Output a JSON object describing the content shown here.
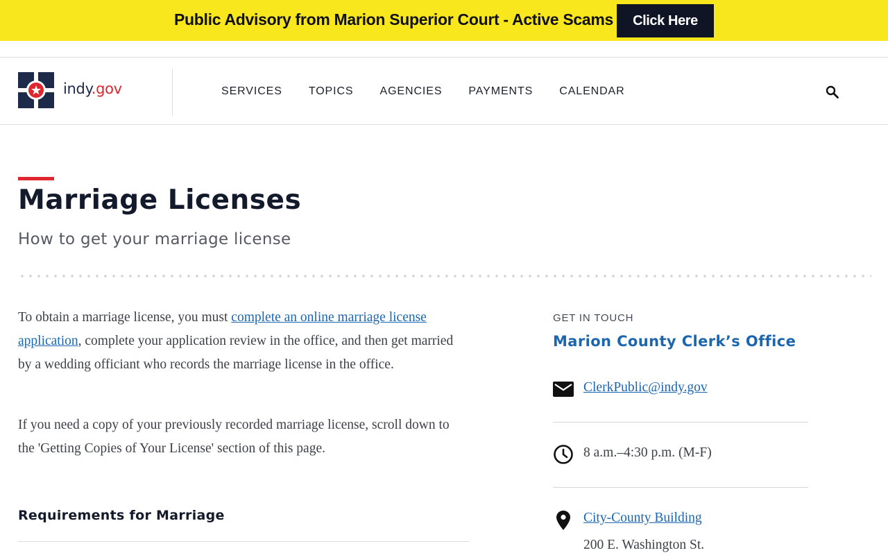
{
  "advisory": {
    "text": "Public Advisory from Marion Superior Court - Active Scams",
    "button_label": "Click Here",
    "background_color": "#f8e71c",
    "button_color": "#0f1524"
  },
  "header": {
    "logo": {
      "word_part1": "indy",
      "word_part2": ".gov",
      "icon": "indy-star-logo-icon"
    },
    "nav": [
      "SERVICES",
      "TOPICS",
      "AGENCIES",
      "PAYMENTS",
      "CALENDAR"
    ],
    "search_icon": "search-icon"
  },
  "page": {
    "title": "Marriage Licenses",
    "subtitle": "How to get your marriage license",
    "accent_color": "#e0262f"
  },
  "content": {
    "intro_before_link": "To obtain a marriage license, you must ",
    "intro_link": "complete an online marriage license application",
    "intro_after_link": ", complete your application review in the office, and then get married by a wedding officiant who records the marriage license in the office.",
    "copies_text": "If you need a copy of your previously recorded marriage license, scroll down to the 'Getting Copies of Your License' section of this page.",
    "requirements_heading": "Requirements for Marriage",
    "link_color": "#1c66b0"
  },
  "contact": {
    "eyebrow": "GET IN TOUCH",
    "office": "Marion County Clerk’s Office",
    "email": "ClerkPublic@indy.gov",
    "email_icon": "envelope-icon",
    "hours": "8 a.m.–4:30 p.m. (M-F)",
    "hours_icon": "clock-icon",
    "location_link": "City-County Building",
    "address_line1": "200 E. Washington St.",
    "location_icon": "map-pin-icon"
  }
}
